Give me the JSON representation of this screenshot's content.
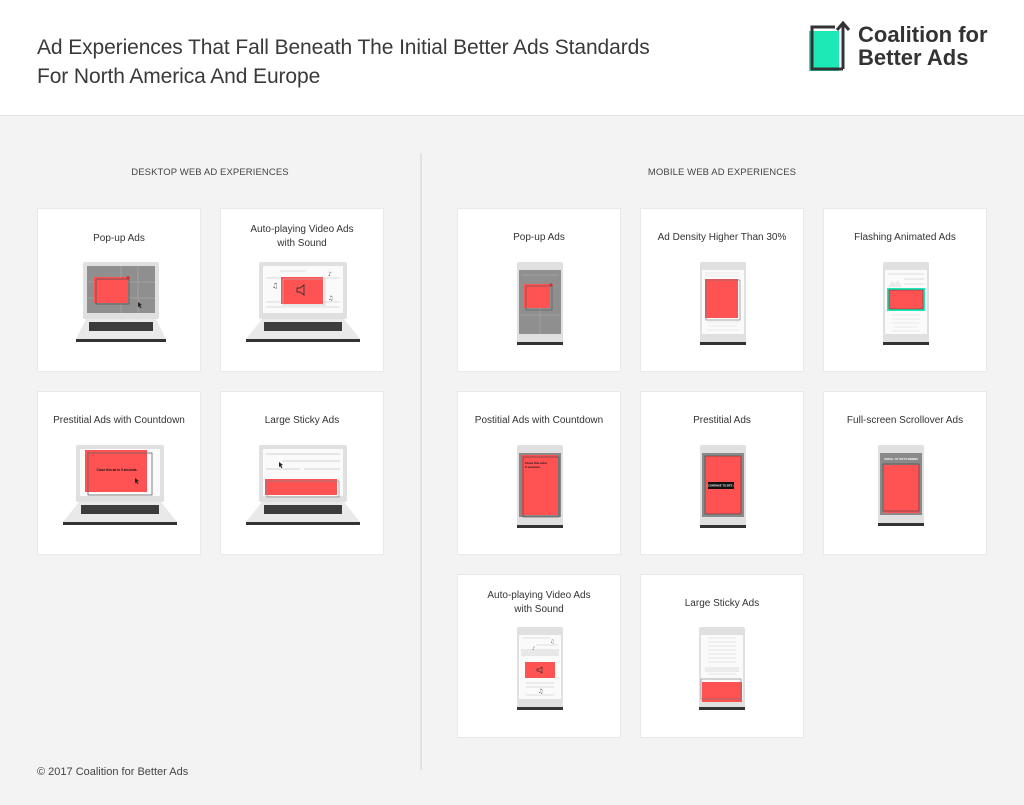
{
  "header": {
    "title_lines": [
      "Ad Experiences That Fall Beneath The Initial Better Ads Standards",
      "For North America And Europe"
    ],
    "logo": {
      "icon": "coalition-logo-icon",
      "lines": [
        "Coalition for",
        "Better Ads"
      ],
      "accent": "#1de9b6"
    }
  },
  "colors": {
    "ad_red": "#ff5252",
    "device_gray": "#e0e0e0",
    "screen_dark": "#8a8a8a",
    "flash_green": "#1de9b6"
  },
  "desktop": {
    "title": "DESKTOP WEB AD EXPERIENCES",
    "cards": [
      {
        "label_lines": [
          "Pop-up Ads"
        ],
        "illustration": "laptop-popup-icon"
      },
      {
        "label_lines": [
          "Auto-playing Video Ads",
          "with Sound"
        ],
        "illustration": "laptop-autoplay-video-icon"
      },
      {
        "label_lines": [
          "Prestitial Ads with Countdown"
        ],
        "illustration": "laptop-prestitial-countdown-icon",
        "ad_text": "Close this ad in 5 seconds."
      },
      {
        "label_lines": [
          "Large Sticky Ads"
        ],
        "illustration": "laptop-sticky-ad-icon"
      }
    ]
  },
  "mobile": {
    "title": "MOBILE WEB AD EXPERIENCES",
    "cards": [
      {
        "label_lines": [
          "Pop-up Ads"
        ],
        "illustration": "phone-popup-icon"
      },
      {
        "label_lines": [
          "Ad Density Higher Than 30%"
        ],
        "illustration": "phone-ad-density-icon"
      },
      {
        "label_lines": [
          "Flashing Animated Ads"
        ],
        "illustration": "phone-flashing-ad-icon"
      },
      {
        "label_lines": [
          "Postitial Ads with Countdown"
        ],
        "illustration": "phone-postitial-countdown-icon",
        "ad_text": [
          "Close this ad in",
          "5 seconds."
        ]
      },
      {
        "label_lines": [
          "Prestitial Ads"
        ],
        "illustration": "phone-prestitial-icon",
        "ad_text": "CONTINUE TO SITE ›"
      },
      {
        "label_lines": [
          "Full-screen Scrollover Ads"
        ],
        "illustration": "phone-scrollover-icon",
        "ad_text": "SCROLL TO TOP TO DISMISS"
      },
      {
        "label_lines": [
          "Auto-playing Video Ads",
          "with Sound"
        ],
        "illustration": "phone-autoplay-video-icon"
      },
      {
        "label_lines": [
          "Large Sticky Ads"
        ],
        "illustration": "phone-sticky-ad-icon"
      }
    ]
  },
  "footer": {
    "copyright": "© 2017 Coalition for Better Ads"
  }
}
